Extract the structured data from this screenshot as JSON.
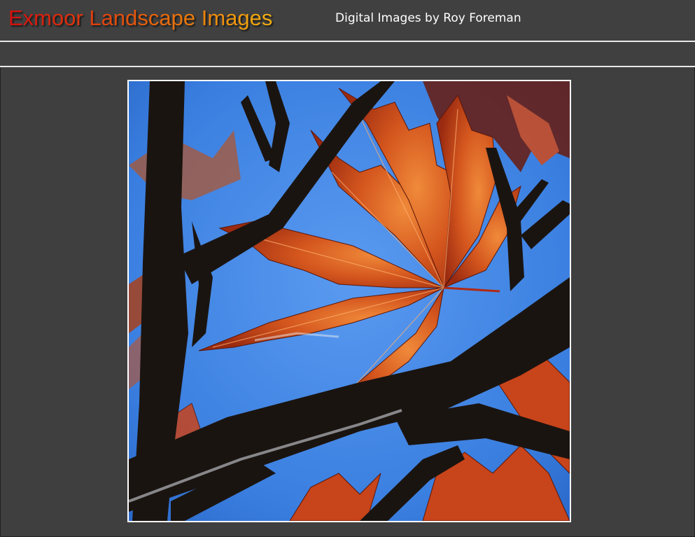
{
  "header": {
    "title": "Exmoor Landscape Images",
    "subtitle": "Digital Images by Roy Foreman"
  },
  "colors": {
    "background": "#3f3f3f",
    "rule": "#e8e8e8",
    "title_gradient": [
      "#d40f0f",
      "#e9740c",
      "#f2b010"
    ],
    "sky": "#3a7fe0",
    "leaf": "#c8441a",
    "branch": "#1a1410"
  },
  "photo": {
    "subject": "red-maple-leaf-photo",
    "icon": "photo-icon"
  }
}
